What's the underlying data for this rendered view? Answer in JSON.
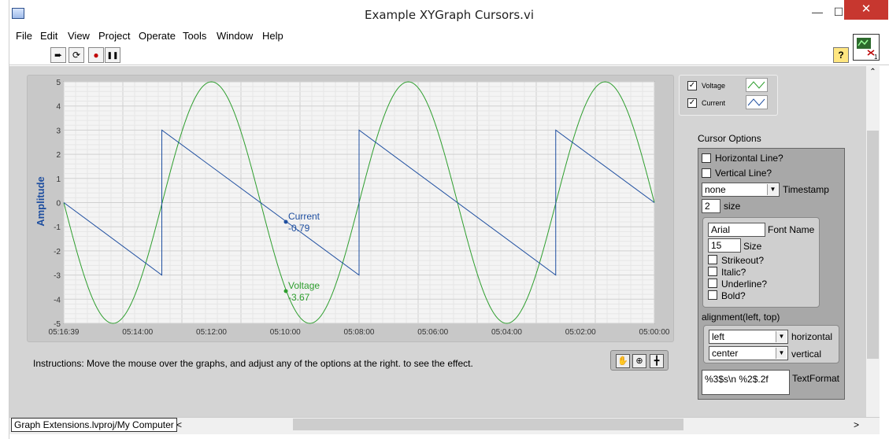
{
  "window": {
    "title": "Example XYGraph Cursors.vi",
    "minimize": "—",
    "maximize": "☐",
    "close": "✕"
  },
  "menu": [
    "File",
    "Edit",
    "View",
    "Project",
    "Operate",
    "Tools",
    "Window",
    "Help"
  ],
  "toolbar": {
    "run": "➨",
    "run_continuous": "⟳",
    "abort": "●",
    "pause": "❚❚",
    "help": "?"
  },
  "graph": {
    "ylabel": "Amplitude",
    "yticks": [
      "5",
      "4",
      "3",
      "2",
      "1",
      "0",
      "-1",
      "-2",
      "-3",
      "-4",
      "-5"
    ],
    "xticks": [
      "05:16:39",
      "05:14:00",
      "05:12:00",
      "05:10:00",
      "05:08:00",
      "05:06:00",
      "05:04:00",
      "05:02:00",
      "05:00:00"
    ],
    "cursor_current_name": "Current",
    "cursor_current_value": "-0.79",
    "cursor_voltage_name": "Voltage",
    "cursor_voltage_value": "-3.67"
  },
  "chart_data": {
    "type": "line",
    "ylabel": "Amplitude",
    "ylim": [
      -5,
      5
    ],
    "x_range": [
      "05:16:39",
      "05:00:00"
    ],
    "grid": true,
    "legend_placement": "right",
    "series": [
      {
        "name": "Voltage",
        "shape": "sine",
        "amplitude": 5,
        "periods": 3,
        "color": "#2e9e2e",
        "points": [
          [
            0,
            0
          ],
          [
            0.083,
            -5
          ],
          [
            0.167,
            0
          ],
          [
            0.25,
            5
          ],
          [
            0.333,
            0
          ],
          [
            0.417,
            -5
          ],
          [
            0.5,
            0
          ],
          [
            0.583,
            5
          ],
          [
            0.667,
            0
          ],
          [
            0.75,
            -5
          ],
          [
            0.833,
            0
          ],
          [
            0.917,
            5
          ],
          [
            1.0,
            0
          ]
        ]
      },
      {
        "name": "Current",
        "shape": "sawtooth",
        "color": "#1f4fa0",
        "points": [
          [
            0,
            0
          ],
          [
            0.166,
            -3
          ],
          [
            0.166,
            3
          ],
          [
            0.5,
            -3
          ],
          [
            0.5,
            3
          ],
          [
            0.833,
            -3
          ],
          [
            0.833,
            3
          ],
          [
            1.0,
            0
          ]
        ]
      }
    ],
    "cursors": [
      {
        "name": "Current",
        "value": -0.79
      },
      {
        "name": "Voltage",
        "value": -3.67
      }
    ]
  },
  "legend": [
    {
      "name": "Voltage",
      "checked": true,
      "color": "#2e9e2e"
    },
    {
      "name": "Current",
      "checked": true,
      "color": "#1f4fa0"
    }
  ],
  "instructions": "Instructions: Move the mouse over the graphs, and adjust any of the options at the right. to see the effect.",
  "cursor_options": {
    "label": "Cursor Options",
    "horizontal_line": "Horizontal Line?",
    "vertical_line": "Vertical Line?",
    "timestamp_value": "none",
    "timestamp_label": "Timestamp",
    "size_value": "2",
    "size_label": "size",
    "font_name_value": "Arial",
    "font_name_label": "Font Name",
    "font_size_value": "15",
    "font_size_label": "Size",
    "strikeout": "Strikeout?",
    "italic": "Italic?",
    "underline": "Underline?",
    "bold": "Bold?",
    "alignment_label": "alignment(left, top)",
    "horizontal_value": "left",
    "horizontal_label": "horizontal",
    "vertical_value": "center",
    "vertical_label": "vertical",
    "textformat_value": "%3$s\\n %2$.2f",
    "textformat_label": "TextFormat"
  },
  "statusbar": {
    "project_path": "Graph Extensions.lvproj/My Computer",
    "scroll_left": "<",
    "scroll_right": ">"
  }
}
